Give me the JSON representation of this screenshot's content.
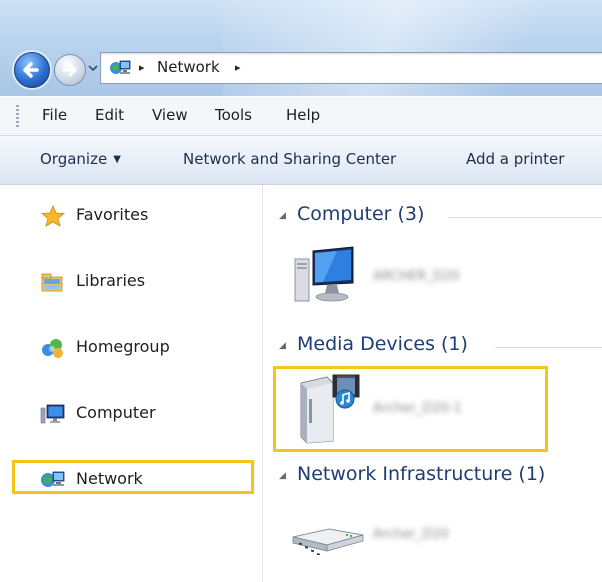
{
  "address_bar": {
    "location": "Network",
    "separator": "▸"
  },
  "menu": {
    "items": [
      "File",
      "Edit",
      "View",
      "Tools",
      "Help"
    ]
  },
  "command_bar": {
    "organize": "Organize",
    "network_sharing": "Network and Sharing Center",
    "add_printer": "Add a printer"
  },
  "nav_pane": {
    "items": [
      {
        "label": "Favorites",
        "icon": "star-icon"
      },
      {
        "label": "Libraries",
        "icon": "libraries-icon"
      },
      {
        "label": "Homegroup",
        "icon": "homegroup-icon"
      },
      {
        "label": "Computer",
        "icon": "computer-icon"
      },
      {
        "label": "Network",
        "icon": "network-icon",
        "selected": true
      }
    ]
  },
  "content": {
    "groups": [
      {
        "header": "Computer (3)",
        "devices": [
          {
            "name": "ARCHER_D20",
            "icon": "computer-monitor-icon"
          }
        ]
      },
      {
        "header": "Media Devices (1)",
        "devices": [
          {
            "name": "Archer_D20-1",
            "icon": "media-server-icon"
          }
        ]
      },
      {
        "header": "Network Infrastructure (1)",
        "devices": [
          {
            "name": "Archer_D20",
            "icon": "router-icon"
          }
        ]
      }
    ]
  },
  "colors": {
    "highlight": "#f5c518",
    "group_header": "#1e3d73"
  }
}
